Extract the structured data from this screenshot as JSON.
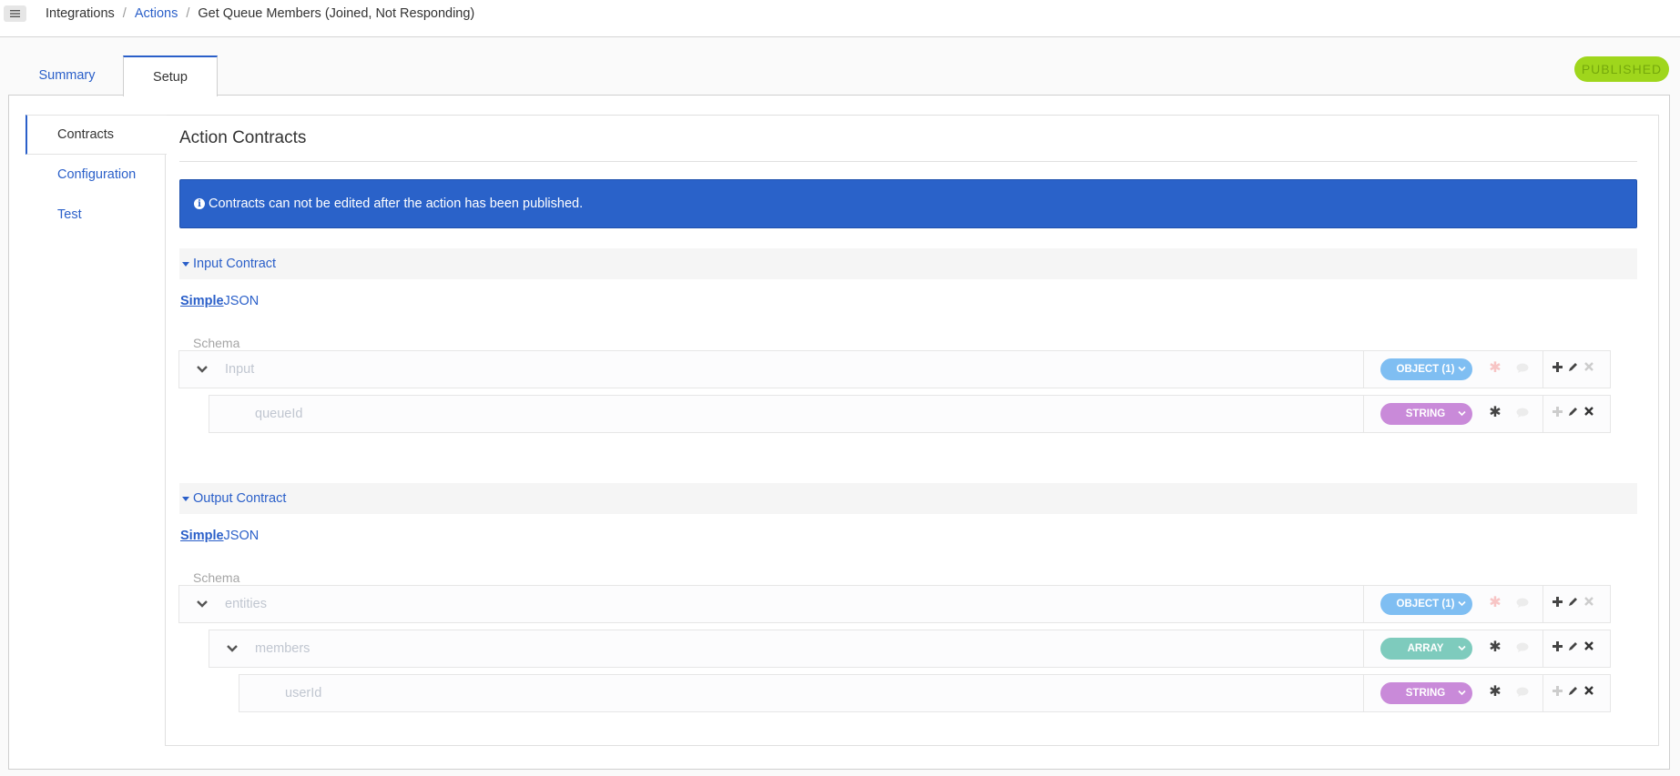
{
  "topbar": {
    "menu_icon": "hamburger-icon",
    "breadcrumb": [
      {
        "label": "Integrations",
        "link": false
      },
      {
        "label": "Actions",
        "link": true
      },
      {
        "label": "Get Queue Members (Joined, Not Responding)",
        "link": false
      }
    ],
    "separator": "/"
  },
  "tabs": {
    "summary": "Summary",
    "setup": "Setup",
    "active": "Setup"
  },
  "status_badge": "PUBLISHED",
  "side_nav": {
    "contracts": "Contracts",
    "configuration": "Configuration",
    "test": "Test",
    "active": "Contracts"
  },
  "main": {
    "title": "Action Contracts",
    "alert": "Contracts can not be edited after the action has been published.",
    "input_contract": {
      "header": "Input Contract",
      "mode_simple": "Simple",
      "mode_json": "JSON",
      "schema_label": "Schema",
      "rows": [
        {
          "name": "Input",
          "type": "OBJECT (1)",
          "required": false
        },
        {
          "name": "queueId",
          "type": "STRING",
          "required": true
        }
      ]
    },
    "output_contract": {
      "header": "Output Contract",
      "mode_simple": "Simple",
      "mode_json": "JSON",
      "schema_label": "Schema",
      "rows": [
        {
          "name": "entities",
          "type": "OBJECT (1)",
          "required": false
        },
        {
          "name": "members",
          "type": "ARRAY",
          "required": true
        },
        {
          "name": "userId",
          "type": "STRING",
          "required": true
        }
      ]
    }
  },
  "colors": {
    "accent": "#2a5fc9",
    "alert_bg": "#2a62c9",
    "badge": "#9fd61c",
    "object_pill": "#7fbef2",
    "string_pill": "#c98ad9",
    "array_pill": "#7ecbbd"
  }
}
